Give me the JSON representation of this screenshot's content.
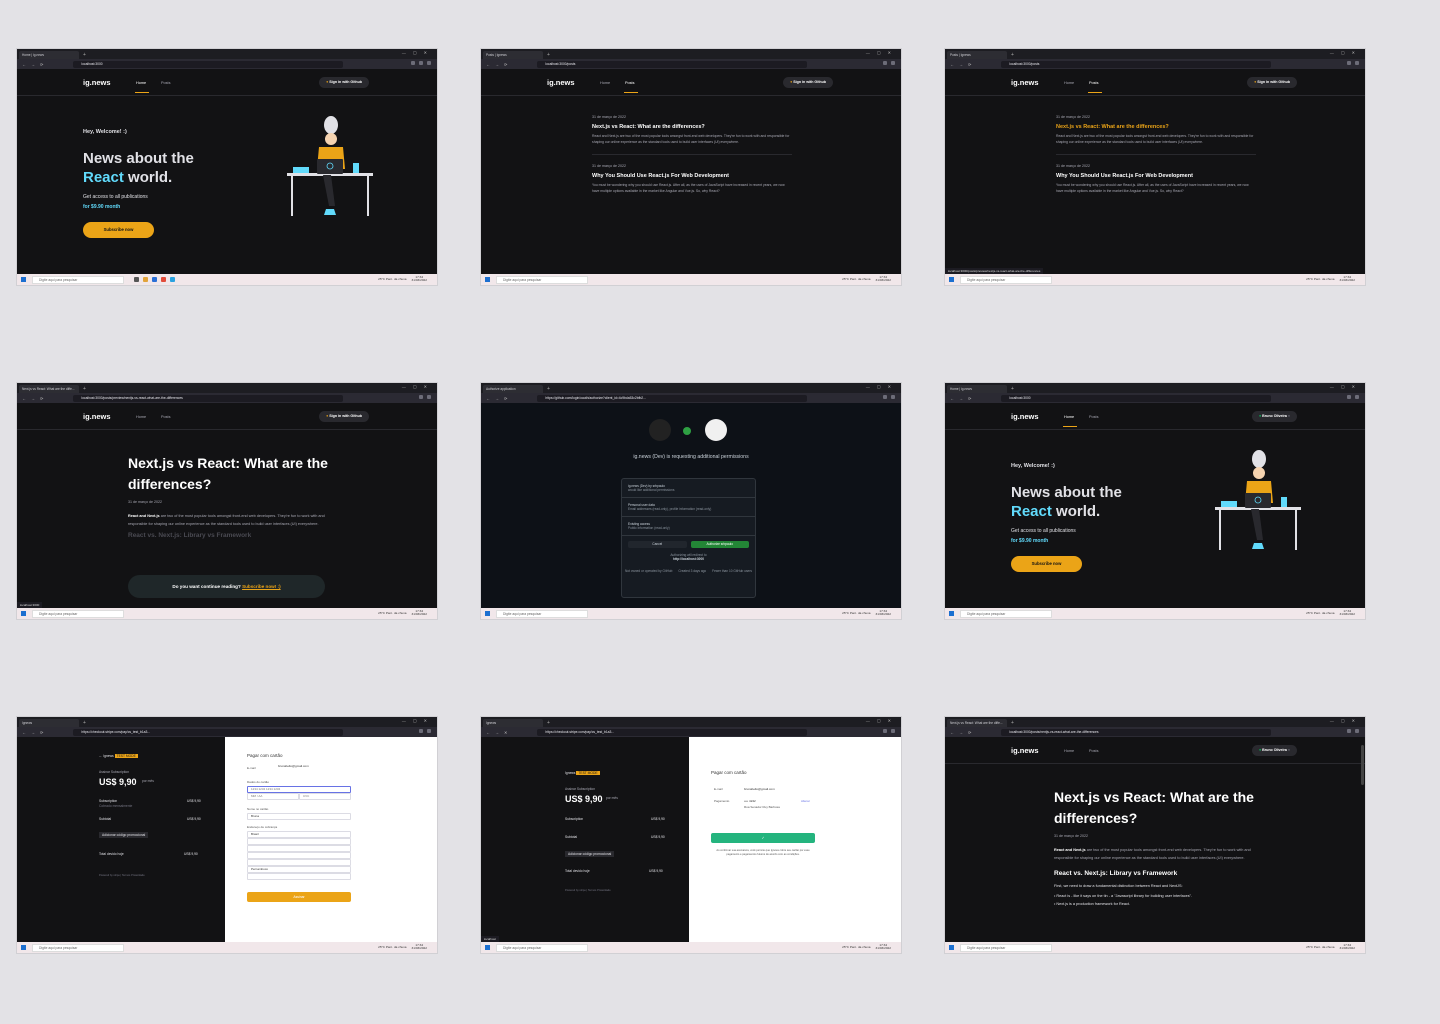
{
  "browser": {
    "taskbar_search_placeholder": "Digite aqui para pesquisar",
    "weather": "25°C Parc. da chuva",
    "clock_time": "17:34",
    "clock_date": "31/03/2022",
    "url_home": "localhost:3000",
    "url_posts": "localhost:3000/posts",
    "url_preview": "localhost:3000/posts/preview/nextjs-vs-react-what-are-the-differences",
    "url_github": "https://github.com/login/oauth/authorize?client_id=4c9bda53c2bfb2...",
    "url_stripe": "https://checkout.stripe.com/pay/cs_test_b1a3...",
    "url_post": "localhost:3000/posts/nextjs-vs-react-what-are-the-differences",
    "tab_home": "Home | ig.news",
    "tab_posts": "Posts | Ignews",
    "tab_article": "Next.js vs React: What are the diffe...",
    "tab_github": "Authorize application",
    "tab_stripe": "Ignews",
    "status_link": "localhost:3000/posts/preview/nextjs-vs-react-what-are-the-differences",
    "status_preview": "localhost:3000",
    "status_stripe": "localhost"
  },
  "site": {
    "logo": "ig.news",
    "nav_home": "Home",
    "nav_posts": "Posts",
    "signin_label": "Sign in with Github",
    "user_name": "Bruno Oliveira",
    "user_close": "×",
    "github_icon": "github-icon"
  },
  "home": {
    "greeting": "Hey, Welcome! :)",
    "headline_1": "News about the",
    "headline_react": "React",
    "headline_2": " world.",
    "access": "Get access to all publications",
    "price": "for $9.90 month",
    "subscribe": "Subscribe now"
  },
  "posts": [
    {
      "date": "31 de março de 2022",
      "title": "Next.js vs React: What are the differences?",
      "excerpt": "React and Next.js are two of the most popular tools amongst front-end web developers. They're fun to work with and responsible for shaping our online experience as the standard tools used to build user interfaces (UI) everywhere."
    },
    {
      "date": "31 de março de 2022",
      "title": "Why You Should Use React.js For Web Development",
      "excerpt": "You must be wondering why you should use React.js. After all, as the uses of JavaScript have increased in recent years, we now have multiple options available in the market like Angular and Vue.js. So, why React?"
    }
  ],
  "article": {
    "title": "Next.js vs React: What are the differences?",
    "date": "31 de março de 2022",
    "p1_bold": "React and Next.js",
    "p1": " are two of the most popular tools amongst front-end web developers. They're fun to work with and responsible for shaping our online experience as the standard tools used to build user interfaces (UI) everywhere.",
    "h2": "React vs. Next.js: Library vs Framework",
    "p2": "First, we need to draw a fundamental distinction between React and NextJS:",
    "li1": "React is - like it says on the tin - a \"Javascript library for building user interfaces\".",
    "li2": "Next.js is a production framework for React.",
    "continue_text": "Do you want continue reading? ",
    "continue_link": "Subscribe now! :)"
  },
  "github": {
    "title": "ig.news (Dev) is requesting additional permissions",
    "app_line": "ig.news (Dev) by srbpaulo",
    "app_sub": "would like additional permissions",
    "personal": "Personal user data",
    "personal_sub": "Email addresses (read-only), profile information (read-only)",
    "existing": "Existing access",
    "existing_sub": "Public information (read-only)",
    "cancel": "Cancel",
    "authorize": "Authorize srbpaulo",
    "redirect": "Authorizing will redirect to",
    "redirect_url": "http://localhost:3000",
    "footer1": "Not owned or operated by GitHub",
    "footer2": "Created 3 days ago",
    "footer3": "Fewer than 10 GitHub users"
  },
  "stripe": {
    "brand": "Ignews",
    "test_badge": "TEST MODE",
    "label": "Assinar Subscription",
    "amount": "US$ 9,90",
    "per": "por mês",
    "line_item": "Subscription",
    "line_item_sub": "Cobrado mensalmente",
    "line_amount": "US$ 9,90",
    "subtotal": "Subtotal",
    "promo": "Adicionar código promocional",
    "total": "Total devido hoje",
    "powered": "Powered by stripe",
    "terms": "Termos",
    "privacy": "Privacidade",
    "pay_title": "Pagar com cartão",
    "email_label": "E-mail",
    "email": "brunabello@gmail.com",
    "card_label": "Dados do cartão",
    "card_placeholder": "1234 1234 1234 1234",
    "exp_placeholder": "MM / AA",
    "cvc_placeholder": "CVC",
    "name_label": "Nome no cartão",
    "name_value": "Bruna",
    "address_label": "Endereço de cobrança",
    "country": "Brasil",
    "state": "Pernambuco",
    "pay_button": "Assinar",
    "payment_label": "Pagamento",
    "card_masked": "•••• 4242",
    "address_masked": "Rua Senador Ruy Barbosa",
    "change": "Alterar",
    "confirm_note": "Ao confirmar sua assinatura, você permite que Ignews cobre seu cartão por esse pagamento e pagamentos futuros de acordo com as condições."
  },
  "colors": {
    "bg": "#121214",
    "yellow": "#eba417",
    "cyan": "#61dafb",
    "green": "#04d361",
    "github_green": "#238636"
  }
}
